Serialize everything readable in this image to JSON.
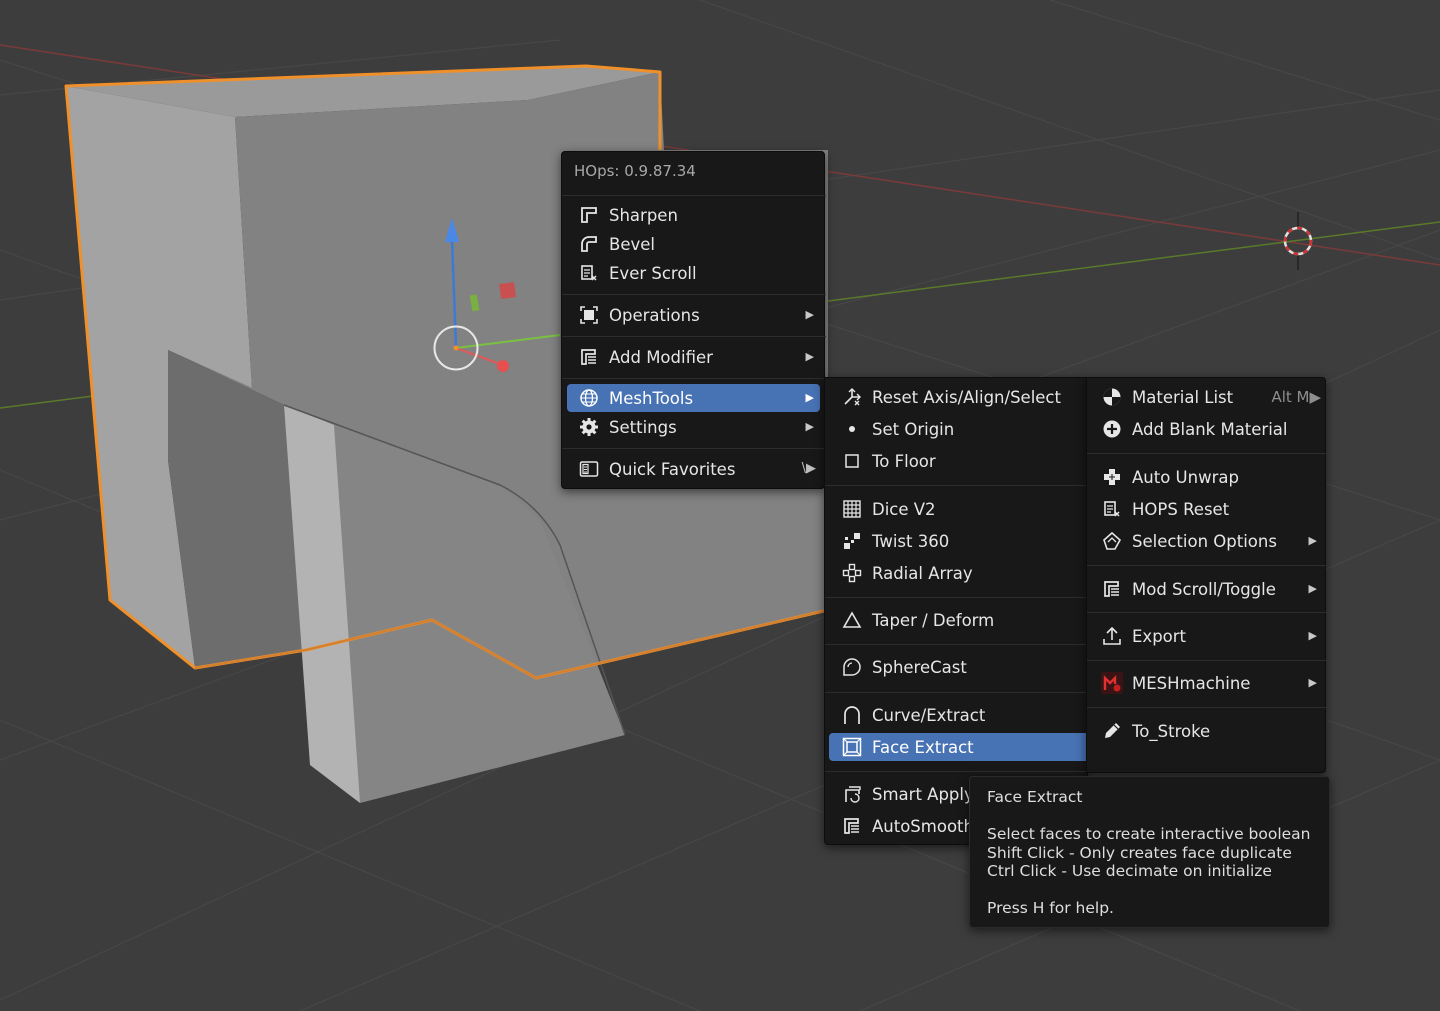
{
  "hops_menu": {
    "title": "HOps: 0.9.87.34",
    "items": [
      {
        "label": "Sharpen",
        "icon": "sharpen-icon"
      },
      {
        "label": "Bevel",
        "icon": "bevel-icon"
      },
      {
        "label": "Ever Scroll",
        "icon": "ever-scroll-icon"
      },
      {
        "label": "Operations",
        "icon": "operations-icon",
        "submenu": true
      },
      {
        "label": "Add Modifier",
        "icon": "add-modifier-icon",
        "submenu": true
      },
      {
        "label": "MeshTools",
        "icon": "globe-icon",
        "submenu": true,
        "active": true
      },
      {
        "label": "Settings",
        "icon": "gear-icon",
        "submenu": true
      },
      {
        "label": "Quick Favorites",
        "icon": "quick-favorites-icon",
        "shortcut": "\\▶"
      }
    ]
  },
  "meshtools_menu": {
    "items": [
      {
        "label": "Reset Axis/Align/Select",
        "icon": "reset-axis-icon"
      },
      {
        "label": "Set Origin",
        "icon": "dot-icon"
      },
      {
        "label": "To Floor",
        "icon": "square-icon"
      },
      {
        "label": "Dice V2",
        "icon": "dice-icon"
      },
      {
        "label": "Twist 360",
        "icon": "twist-icon"
      },
      {
        "label": "Radial Array",
        "icon": "radial-array-icon"
      },
      {
        "label": "Taper / Deform",
        "icon": "triangle-icon"
      },
      {
        "label": "SphereCast",
        "icon": "spherecast-icon"
      },
      {
        "label": "Curve/Extract",
        "icon": "curve-icon"
      },
      {
        "label": "Face Extract",
        "icon": "face-extract-icon",
        "active": true
      },
      {
        "label": "Smart Apply",
        "icon": "smart-apply-icon"
      },
      {
        "label": "AutoSmooth",
        "icon": "autosmooth-icon"
      }
    ]
  },
  "right_menu": {
    "items": [
      {
        "label": "Material List",
        "icon": "material-icon",
        "shortcut": "Alt M▶"
      },
      {
        "label": "Add Blank Material",
        "icon": "plus-circle-icon"
      },
      {
        "label": "Auto Unwrap",
        "icon": "unwrap-icon"
      },
      {
        "label": "HOPS Reset",
        "icon": "hops-reset-icon"
      },
      {
        "label": "Selection Options",
        "icon": "selection-icon",
        "submenu": true
      },
      {
        "label": "Mod Scroll/Toggle",
        "icon": "mod-scroll-icon",
        "submenu": true
      },
      {
        "label": "Export",
        "icon": "export-icon",
        "submenu": true
      },
      {
        "label": "MESHmachine",
        "icon": "meshmachine-icon",
        "submenu": true
      },
      {
        "label": "To_Stroke",
        "icon": "pencil-icon"
      }
    ]
  },
  "tooltip": {
    "title": "Face Extract",
    "lines": [
      "Select faces to create interactive boolean",
      "Shift Click - Only creates face duplicate",
      "Ctrl Click - Use decimate on initialize"
    ],
    "help": "Press H for help."
  },
  "colors": {
    "background": "#3d3d3d",
    "menu_bg": "#181818",
    "active_item": "#4772b3",
    "selection_outline": "#f0902a",
    "mesh_face": "#8f8f8f"
  }
}
